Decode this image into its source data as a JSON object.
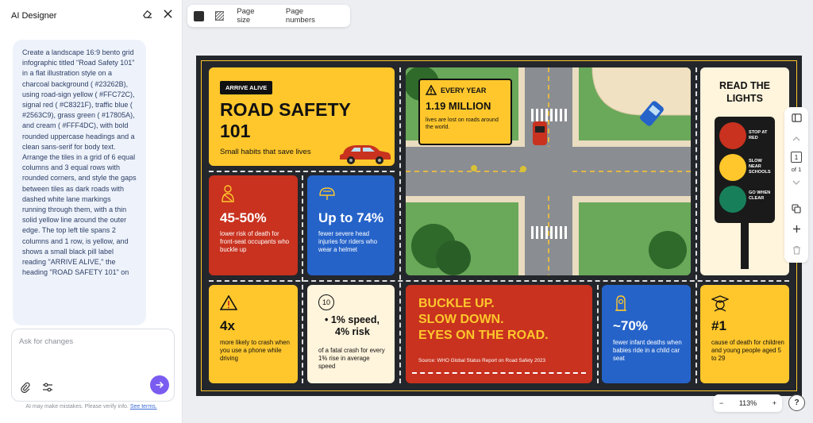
{
  "panel": {
    "title": "AI Designer",
    "prompt": "Create a landscape 16:9 bento grid infographic titled \"Road Safety 101\" in a flat illustration style on a charcoal background ( #23262B), using road-sign yellow ( #FFC72C), signal red ( #C8321F), traffic blue ( #2563C9), grass green ( #17805A), and cream ( #FFF4DC), with bold rounded uppercase headings and a clean sans-serif for body text. Arrange the tiles in a grid of 6 equal columns and 3 equal rows with rounded corners, and style the gaps between tiles as dark roads with dashed white lane markings running through them, with a thin solid yellow line around the outer edge. The top left tile spans 2 columns and 1 row, is yellow, and shows a small black pill label reading \"ARRIVE ALIVE,\" the heading \"ROAD SAFETY 101\" on",
    "input_placeholder": "Ask for changes",
    "disclaimer": "AI may make mistakes. Please verify info.",
    "disclaimer_link": "See terms."
  },
  "toolbar": {
    "page_size": "Page size",
    "page_numbers": "Page numbers"
  },
  "rail": {
    "page_current": "1",
    "page_of": "of 1"
  },
  "zoom": {
    "level": "113%",
    "minus": "−",
    "plus": "+"
  },
  "help": "?",
  "colors": {
    "charcoal": "#23262B",
    "yellow": "#FFC72C",
    "red": "#C8321F",
    "blue": "#2563C9",
    "green": "#17805A",
    "cream": "#FFF4DC",
    "accent": "#7b5cf0"
  },
  "infographic": {
    "pill": "ARRIVE ALIVE",
    "title_line1": "ROAD SAFETY",
    "title_line2": "101",
    "subtitle": "Small habits that save lives",
    "every_year_label": "EVERY YEAR",
    "every_year_stat": "1.19 MILLION",
    "every_year_desc": "lives are lost on roads around the world.",
    "lights_title": "READ THE LIGHTS",
    "lights": [
      {
        "color": "#C8321F",
        "label": "STOP AT RED"
      },
      {
        "color": "#FFC72C",
        "label": "SLOW NEAR SCHOOLS"
      },
      {
        "color": "#17805A",
        "label": "GO WHEN CLEAR"
      }
    ],
    "seatbelt_stat": "45-50%",
    "seatbelt_desc": "lower risk of death for front-seat occupants who buckle up",
    "helmet_stat": "Up to 74%",
    "helmet_desc": "fewer severe head injuries for riders who wear a helmet",
    "phone_stat": "4x",
    "phone_desc": "more likely to crash when you use a phone while driving",
    "speed_badge": "10",
    "speed_line1": "• 1% speed,",
    "speed_line2": "4% risk",
    "speed_desc": "of a fatal crash for every 1% rise in average speed",
    "slogan1": "BUCKLE UP.",
    "slogan2": "SLOW DOWN.",
    "slogan3": "EYES ON THE ROAD.",
    "source": "Source: WHO Global Status Report on Road Safety 2023",
    "infant_stat": "~70%",
    "infant_desc": "fewer infant deaths when babies ride in a child car seat",
    "rank_stat": "#1",
    "rank_desc": "cause of death for children and young people aged 5 to 29"
  }
}
